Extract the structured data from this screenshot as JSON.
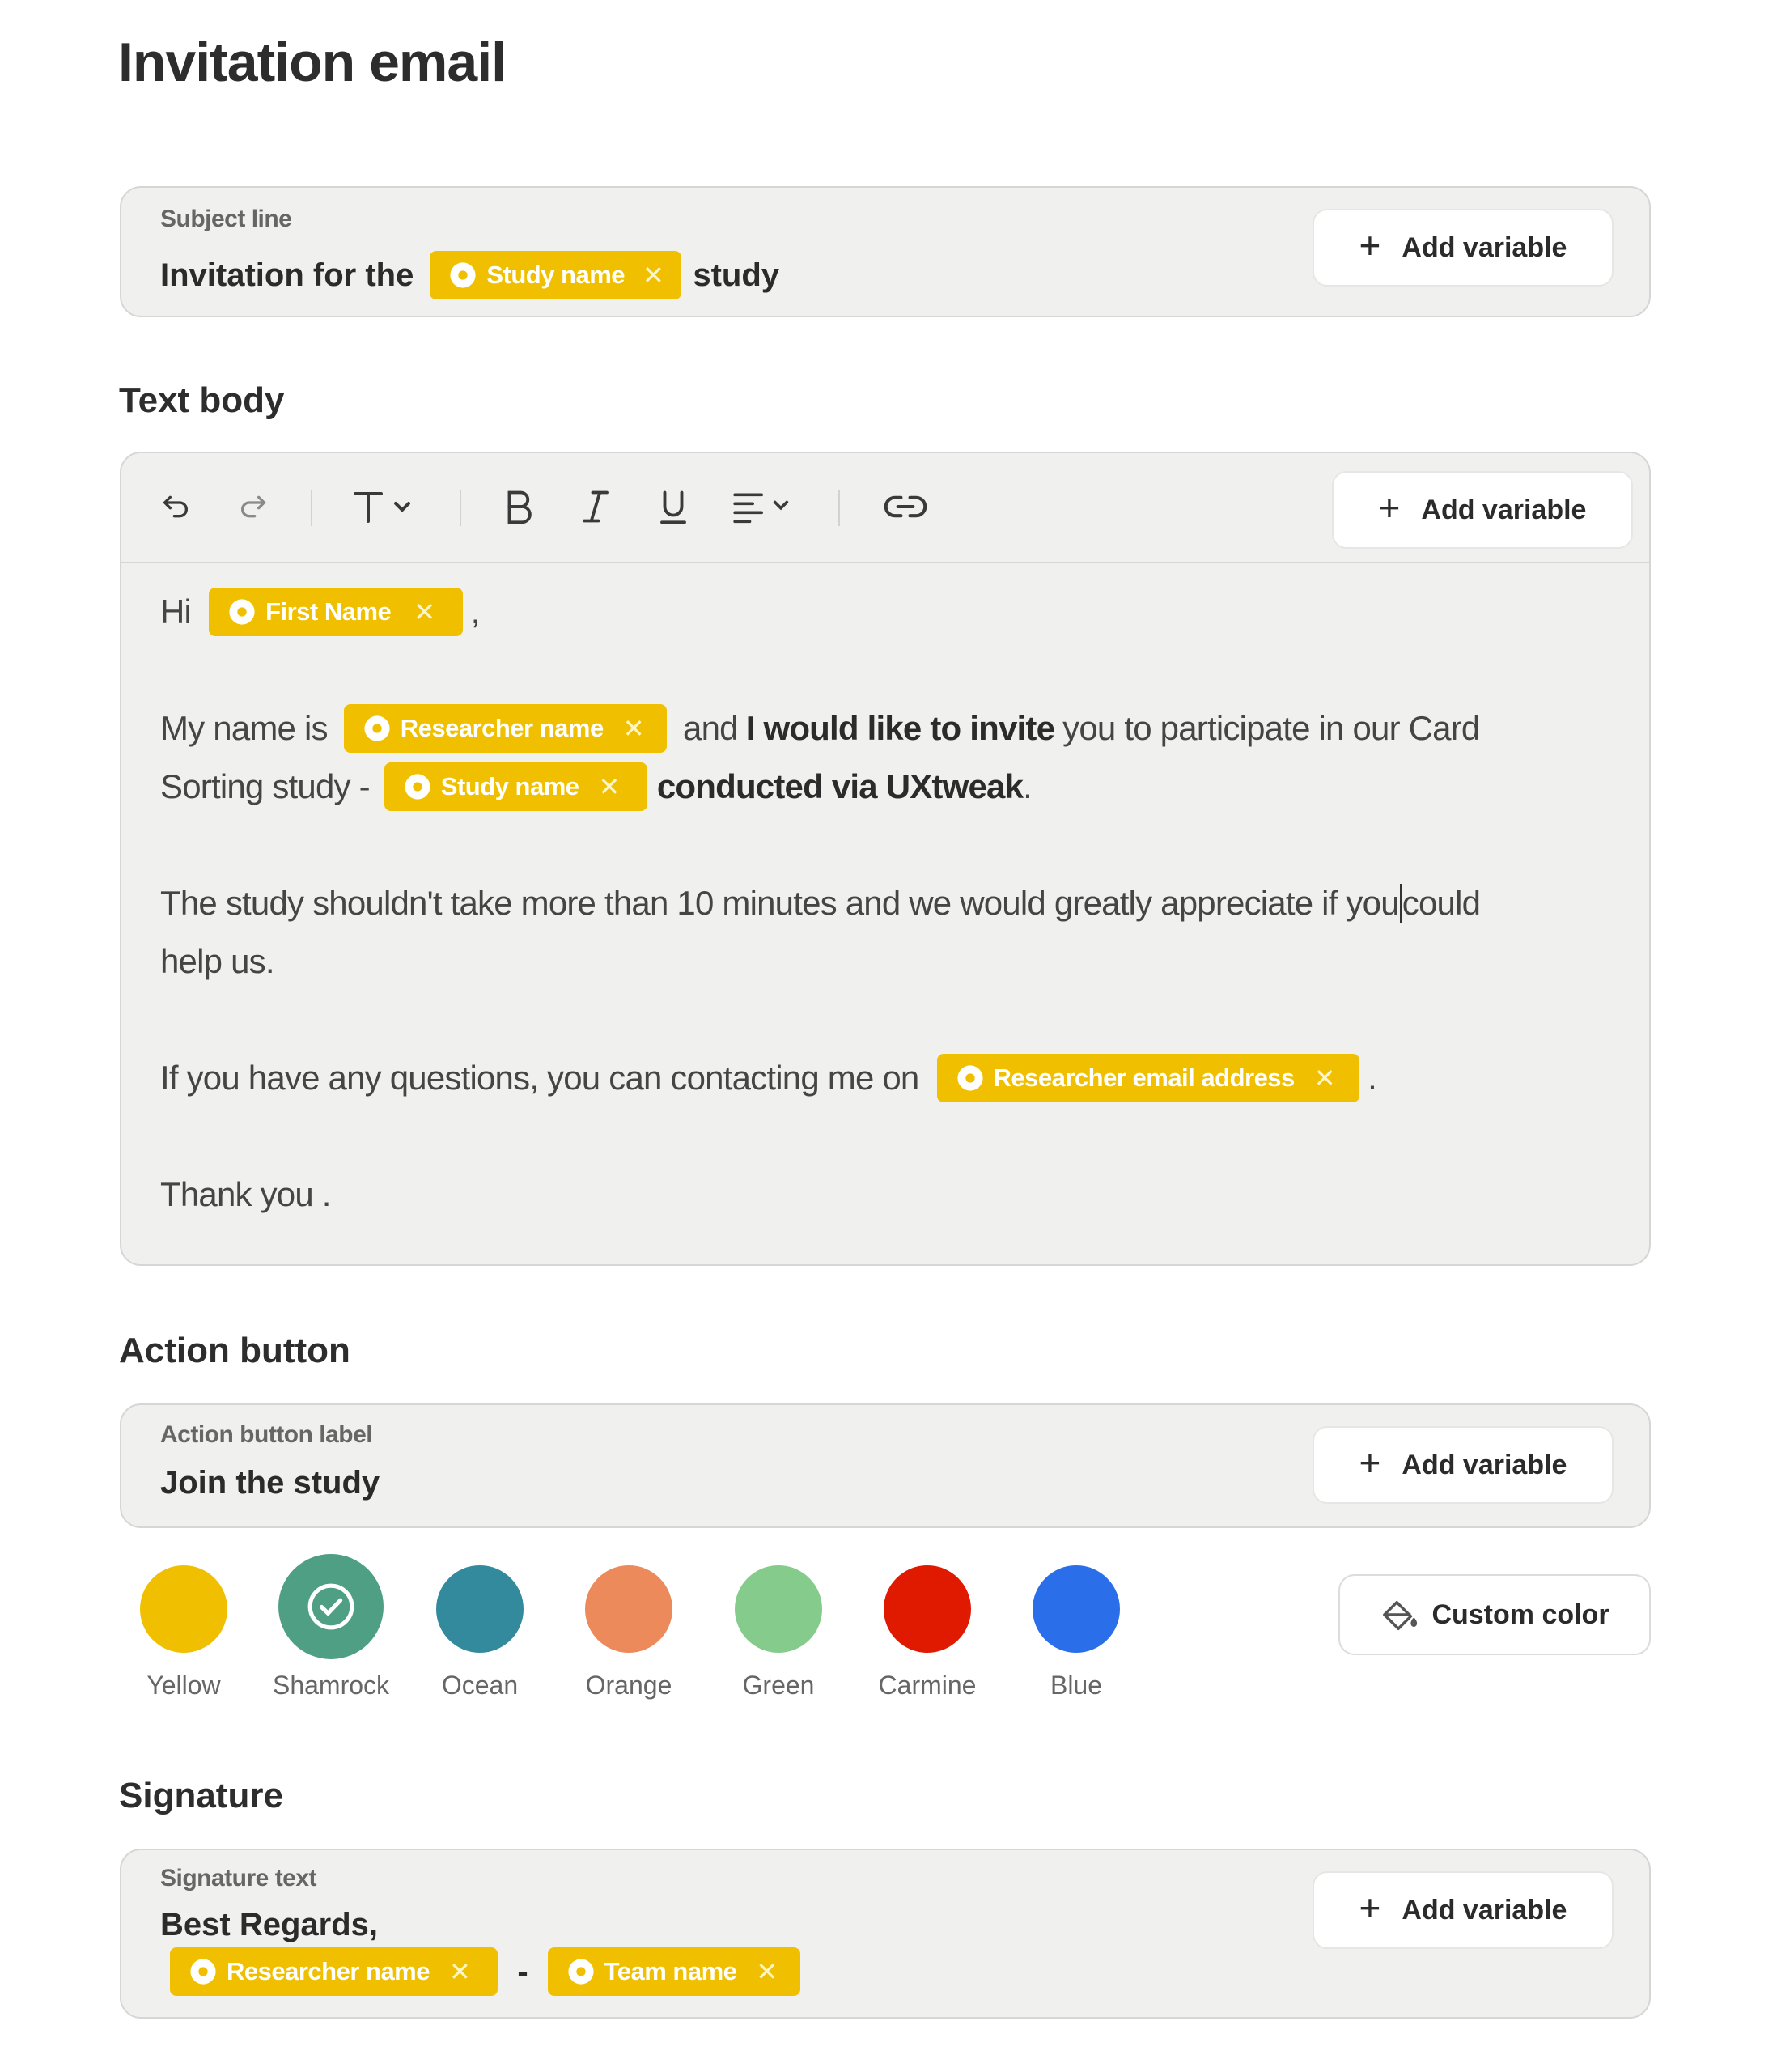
{
  "page": {
    "title": "Invitation email"
  },
  "subject": {
    "label": "Subject line",
    "prefix": "Invitation for the",
    "variable": "Study name",
    "suffix": "study",
    "add_variable": "Add variable"
  },
  "text_body": {
    "heading": "Text body",
    "add_variable": "Add variable",
    "line1": {
      "hi": "Hi",
      "var_first_name": "First Name",
      "comma": ","
    },
    "line2": {
      "my_name_is": "My name is",
      "var_researcher": "Researcher name",
      "and": "and",
      "bold_invite": "I would like to invite",
      "rest": "you to participate in our Card"
    },
    "line3": {
      "sorting": "Sorting study -",
      "var_study": "Study name",
      "bold_conducted": "conducted via UXtweak",
      "period": "."
    },
    "line4": {
      "text_before_caret": "The study shouldn't take more than 10 minutes and we would greatly appreciate if you",
      "text_after_caret": "could"
    },
    "line5": {
      "text": "help us."
    },
    "line6": {
      "text": "If you have any questions, you can contacting me on",
      "var_email": "Researcher email address",
      "period": "."
    },
    "line7": {
      "text": "Thank you ."
    }
  },
  "action_button": {
    "heading": "Action button",
    "label": "Action button label",
    "value": "Join the study",
    "add_variable": "Add variable",
    "colors": [
      {
        "name": "Yellow",
        "hex": "#f0c000",
        "selected": false
      },
      {
        "name": "Shamrock",
        "hex": "#4e9f83",
        "selected": true
      },
      {
        "name": "Ocean",
        "hex": "#328a9c",
        "selected": false
      },
      {
        "name": "Orange",
        "hex": "#ec8a5c",
        "selected": false
      },
      {
        "name": "Green",
        "hex": "#85cb8b",
        "selected": false
      },
      {
        "name": "Carmine",
        "hex": "#df1a00",
        "selected": false
      },
      {
        "name": "Blue",
        "hex": "#2a6fe9",
        "selected": false
      }
    ],
    "custom_color": "Custom color"
  },
  "signature": {
    "heading": "Signature",
    "label": "Signature text",
    "line1": "Best Regards,",
    "var_researcher": "Researcher name",
    "dash": "-",
    "var_team": "Team name",
    "add_variable": "Add variable"
  },
  "icons": {
    "undo": "undo-icon",
    "redo": "redo-icon",
    "text_size": "text-size-icon",
    "bold": "bold-icon",
    "italic": "italic-icon",
    "underline": "underline-icon",
    "align": "align-icon",
    "link": "link-icon",
    "tag": "tag-icon",
    "remove": "close-icon",
    "plus": "plus-icon",
    "check": "check-circle-icon",
    "paint": "paint-bucket-icon"
  }
}
